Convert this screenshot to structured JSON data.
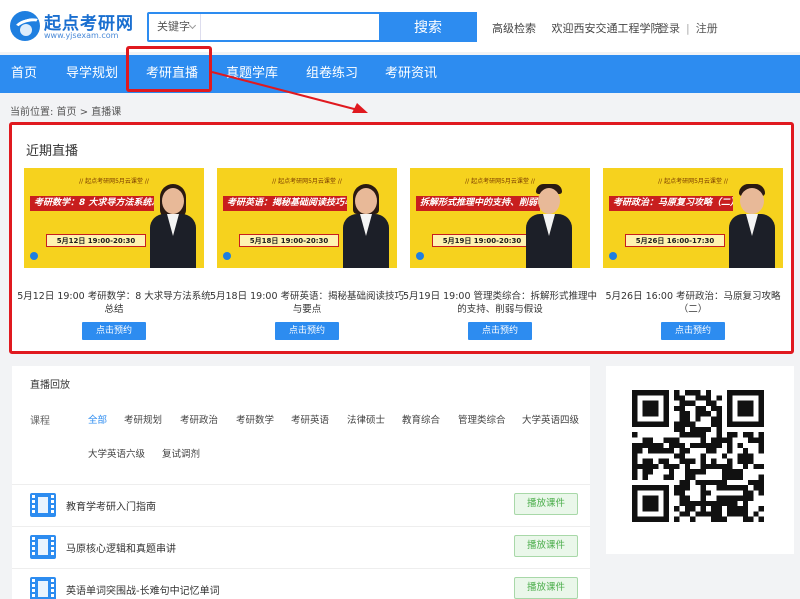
{
  "header": {
    "logo_name": "起点考研网",
    "logo_url": "www.yjsexam.com",
    "search_type": "关键字",
    "search_placeholder": "",
    "search_button": "搜索",
    "advanced_search": "高级检索",
    "welcome": "欢迎西安交通工程学院",
    "login": "登录",
    "register": "注册"
  },
  "nav": {
    "items": [
      "首页",
      "导学规划",
      "考研直播",
      "真题学库",
      "组卷练习",
      "考研资讯"
    ],
    "active": "考研直播"
  },
  "breadcrumb": "当前位置: 首页 > 直播课",
  "live": {
    "title": "近期直播",
    "cards": [
      {
        "banner": "// 起点考研网5月云课堂 //",
        "poster_title": "考研数学：8 大求导方法系统总结",
        "poster_date": "5月12日 19:00-20:30",
        "desc": "5月12日 19:00 考研数学：8 大求导方法系统总结",
        "button": "点击预约"
      },
      {
        "banner": "// 起点考研网5月云课堂 //",
        "poster_title": "考研英语：揭秘基础阅读技巧与要点",
        "poster_date": "5月18日 19:00-20:30",
        "desc": "5月18日 19:00 考研英语：揭秘基础阅读技巧与要点",
        "button": "点击预约"
      },
      {
        "banner": "// 起点考研网5月云课堂 //",
        "poster_title": "拆解形式推理中的支持、削弱与假设",
        "poster_date": "5月19日 19:00-20:30",
        "desc": "5月19日 19:00 管理类综合：拆解形式推理中的支持、削弱与假设",
        "button": "点击预约"
      },
      {
        "banner": "// 起点考研网5月云课堂 //",
        "poster_title": "考研政治：马原复习攻略（二）",
        "poster_date": "5月26日 16:00-17:30",
        "desc": "5月26日 16:00 考研政治：马原复习攻略（二）",
        "button": "点击预约"
      }
    ]
  },
  "replay": {
    "title": "直播回放",
    "course_label": "课程",
    "filters": [
      "全部",
      "考研规划",
      "考研政治",
      "考研数学",
      "考研英语",
      "法律硕士",
      "教育综合",
      "管理类综合",
      "大学英语四级",
      "大学英语六级",
      "复试调剂"
    ],
    "active_filter": "全部",
    "items": [
      {
        "title": "教育学考研入门指南",
        "button": "播放课件"
      },
      {
        "title": "马原核心逻辑和真题串讲",
        "button": "播放课件"
      },
      {
        "title": "英语单词突围战-长难句中记忆单词",
        "button": "播放课件"
      }
    ]
  },
  "colors": {
    "accent": "#2d8cf0",
    "highlight": "#e0191f",
    "poster": "#f6d21e",
    "play_button": "#4cae4c"
  }
}
